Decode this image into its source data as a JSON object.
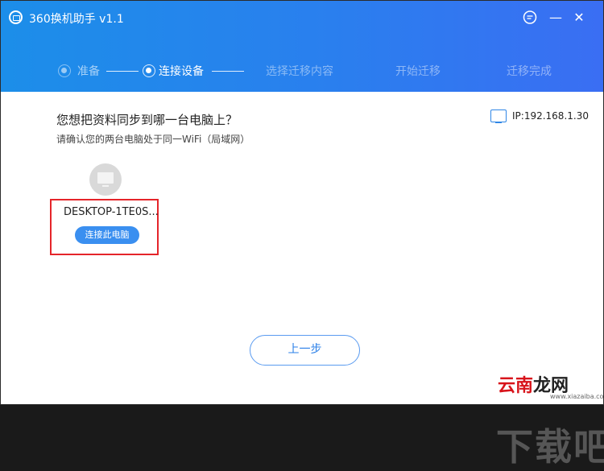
{
  "window": {
    "title": "360换机助手 v1.1"
  },
  "steps": [
    {
      "label": "准备",
      "state": "done"
    },
    {
      "label": "连接设备",
      "state": "active"
    },
    {
      "label": "选择迁移内容",
      "state": "pending"
    },
    {
      "label": "开始迁移",
      "state": "pending"
    },
    {
      "label": "迁移完成",
      "state": "pending"
    }
  ],
  "main": {
    "question": "您想把资料同步到哪一台电脑上？",
    "hint": "请确认您的两台电脑处于同一WiFi（局域网）",
    "ip_label": "IP:192.168.1.30",
    "device": {
      "name": "DESKTOP-1TE0S...",
      "connect_label": "连接此电脑"
    },
    "prev_label": "上一步"
  },
  "watermark": {
    "big": "下载吧",
    "site_red": "云南",
    "site_rest": "龙网",
    "url": "www.xiazaiba.com"
  },
  "colors": {
    "header_start": "#1c8ee9",
    "header_end": "#3a6ef3",
    "primary": "#3a8ff0",
    "highlight": "#e5252a"
  }
}
